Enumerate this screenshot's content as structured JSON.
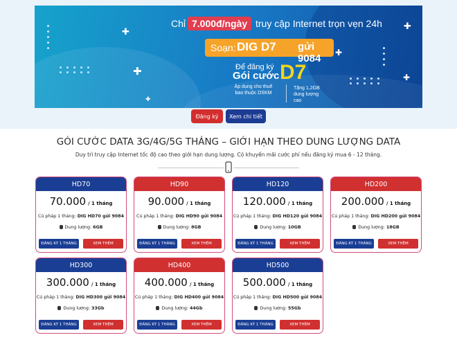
{
  "banner": {
    "pre": "Chỉ",
    "price": "7.000đ/ngày",
    "post": "truy cập Internet trọn vẹn 24h",
    "sms_compose": "Soạn:",
    "sms_code": "DIG D7",
    "sms_to": "gửi 9084",
    "register_line1": "Để đăng ký",
    "register_line2": "Gói cước",
    "package_name": "D7",
    "note_left": "Áp dụng cho thuê bao thuộc DSKM",
    "note_right": "Tặng 1,2GB dung lượng cao"
  },
  "actions": {
    "register": "Đăng ký",
    "detail": "Xem chi tiết"
  },
  "section": {
    "title": "GÓI CƯỚC DATA 3G/4G/5G THÁNG – GIỚI HẠN THEO DUNG LƯỢNG DATA",
    "subtitle": "Duy trì truy cập Internet tốc độ cao theo giới hạn dung lượng. Có khuyến mãi cước phí nếu đăng ký mua 6 - 12 tháng."
  },
  "labels": {
    "per_month": "/ 1 tháng",
    "syntax_prefix": "Cú pháp 1 tháng:",
    "capacity_prefix": "Dung lượng:",
    "register_btn": "ĐĂNG KÝ 1 THÁNG",
    "more_btn": "XEM THÊM"
  },
  "colors": {
    "blue": "#1a3e94",
    "red": "#d03030",
    "card_border": "#d14b7a",
    "promo_yellow": "#f2d41e",
    "sms_orange": "#f6a32a"
  },
  "cards": [
    {
      "name": "HD70",
      "theme": "blue",
      "price": "70.000",
      "syntax": "DIG HD70 gửi 9084",
      "capacity": "6GB"
    },
    {
      "name": "HD90",
      "theme": "red",
      "price": "90.000",
      "syntax": "DIG HD90 gửi 9084",
      "capacity": "8GB"
    },
    {
      "name": "HD120",
      "theme": "blue",
      "price": "120.000",
      "syntax": "DIG HD120 gửi 9084",
      "capacity": "10GB"
    },
    {
      "name": "HD200",
      "theme": "red",
      "price": "200.000",
      "syntax": "DIG HD200 gửi 9084",
      "capacity": "18GB"
    },
    {
      "name": "HD300",
      "theme": "blue",
      "price": "300.000",
      "syntax": "DIG HD300 gửi 9084",
      "capacity": "33Gb"
    },
    {
      "name": "HD400",
      "theme": "red",
      "price": "400.000",
      "syntax": "DIG HD400 gửi 9084",
      "capacity": "44Gb"
    },
    {
      "name": "HD500",
      "theme": "blue",
      "price": "500.000",
      "syntax": "DIG HD500 gửi 9084",
      "capacity": "55Gb"
    }
  ]
}
